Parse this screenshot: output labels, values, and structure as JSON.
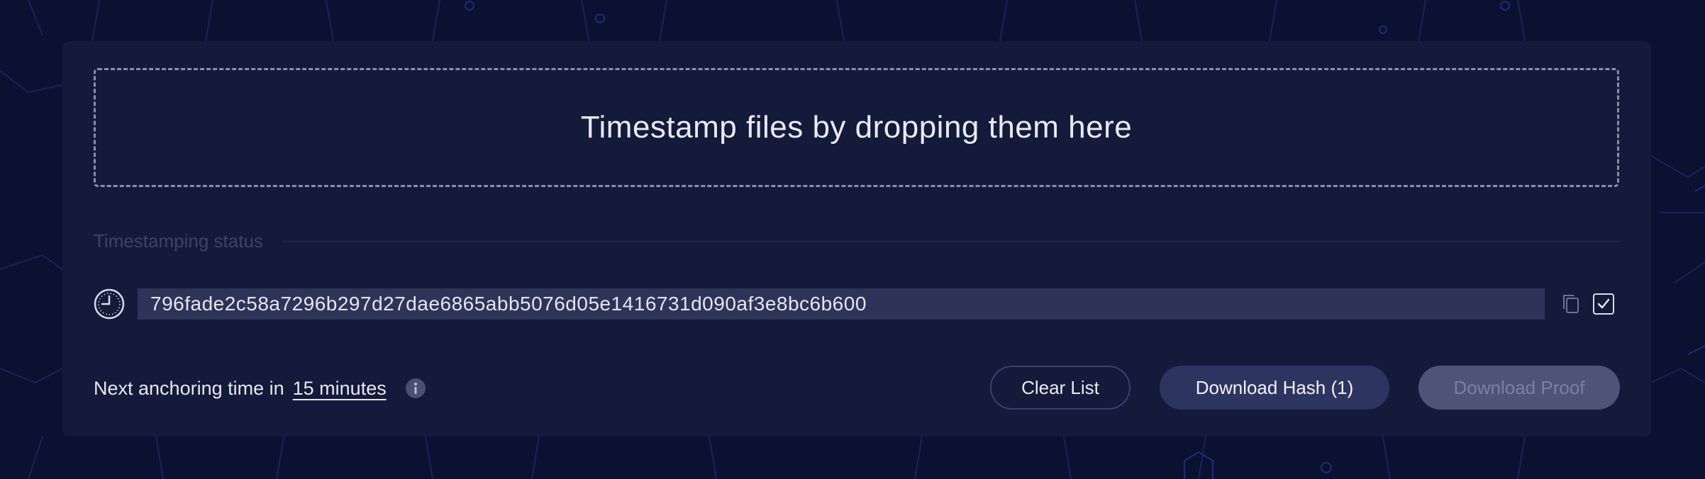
{
  "dropzone": {
    "text": "Timestamp files by dropping them here"
  },
  "status": {
    "label": "Timestamping status"
  },
  "hash_item": {
    "hash": "796fade2c58a7296b297d27dae6865abb5076d05e1416731d090af3e8bc6b600",
    "status_icon": "clock-icon",
    "actions": [
      "copy-icon",
      "checkbox-icon"
    ]
  },
  "footer": {
    "anchoring_prefix": "Next anchoring time in",
    "anchoring_time": "15 minutes",
    "info_icon": "info-icon"
  },
  "buttons": {
    "clear_list": "Clear List",
    "download_hash": "Download Hash (1)",
    "download_proof": "Download Proof"
  },
  "colors": {
    "background": "#0b1130",
    "panel": "#141a3a",
    "hash_box": "#2e3458",
    "disabled_button": "#4e5478"
  }
}
